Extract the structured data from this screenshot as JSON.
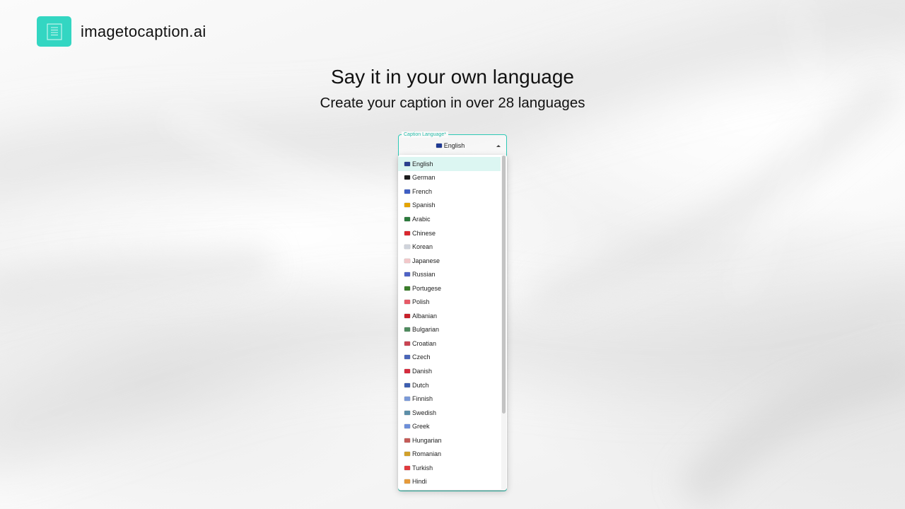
{
  "brand": {
    "name": "imagetocaption.ai",
    "logo_color": "#33d6c2"
  },
  "hero": {
    "title": "Say it in your own language",
    "subtitle": "Create your caption in over 28 languages"
  },
  "language_select": {
    "label": "Caption Language*",
    "selected_label": "English",
    "selected_flag": "#1f3a93",
    "accent_color": "#2ec9b6",
    "options": [
      {
        "label": "English",
        "flag": "#2b3f8f",
        "selected": true
      },
      {
        "label": "German",
        "flag": "#1c1c1c"
      },
      {
        "label": "French",
        "flag": "#3f5fc4"
      },
      {
        "label": "Spanish",
        "flag": "#e5a400"
      },
      {
        "label": "Arabic",
        "flag": "#2c7a3d"
      },
      {
        "label": "Chinese",
        "flag": "#d9282f"
      },
      {
        "label": "Korean",
        "flag": "#cfd3db"
      },
      {
        "label": "Japanese",
        "flag": "#f2c7c9"
      },
      {
        "label": "Russian",
        "flag": "#4f63c5"
      },
      {
        "label": "Portugese",
        "flag": "#3a7d2a"
      },
      {
        "label": "Polish",
        "flag": "#e75a67"
      },
      {
        "label": "Albanian",
        "flag": "#c8212b"
      },
      {
        "label": "Bulgarian",
        "flag": "#4f8b5f"
      },
      {
        "label": "Croatian",
        "flag": "#c94452"
      },
      {
        "label": "Czech",
        "flag": "#4a66b8"
      },
      {
        "label": "Danish",
        "flag": "#d52b3d"
      },
      {
        "label": "Dutch",
        "flag": "#3e5fb0"
      },
      {
        "label": "Finnish",
        "flag": "#7b9ad8"
      },
      {
        "label": "Swedish",
        "flag": "#5c8ea8"
      },
      {
        "label": "Greek",
        "flag": "#6d8fd9"
      },
      {
        "label": "Hungarian",
        "flag": "#c45c58"
      },
      {
        "label": "Romanian",
        "flag": "#d1a02a"
      },
      {
        "label": "Turkish",
        "flag": "#e03a3e"
      },
      {
        "label": "Hindi",
        "flag": "#e69a3a"
      }
    ]
  }
}
